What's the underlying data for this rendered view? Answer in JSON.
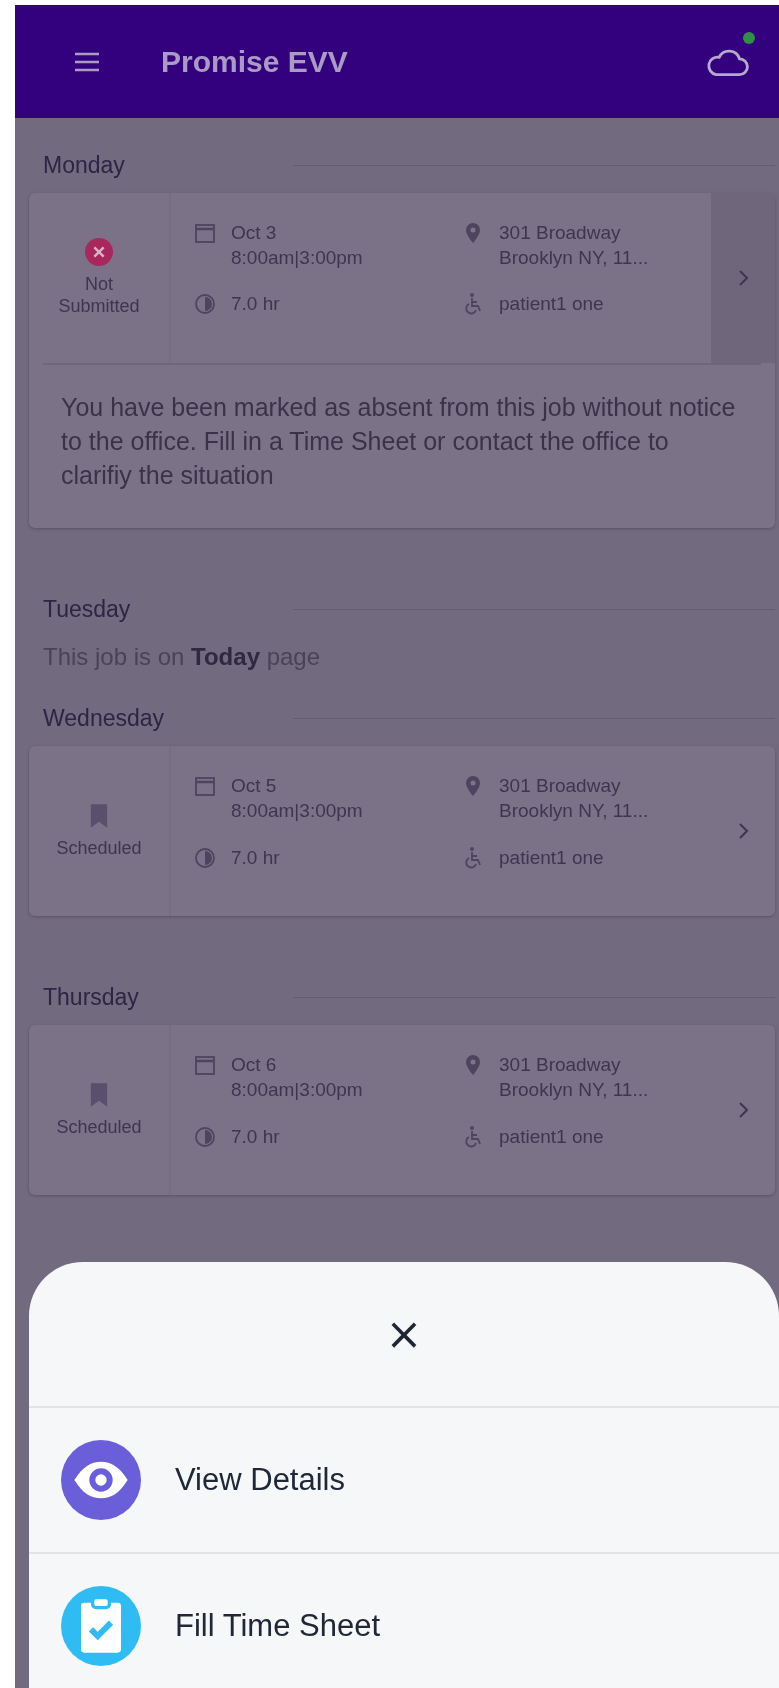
{
  "header": {
    "title": "Promise EVV",
    "connected": true
  },
  "days": [
    {
      "day": "Monday",
      "jobs": [
        {
          "status": {
            "kind": "not_submitted",
            "label": "Not Submitted"
          },
          "date": "Oct 3",
          "time": "8:00am|3:00pm",
          "hours": "7.0 hr",
          "address_1": "301 Broadway",
          "address_2": "Brooklyn NY, 11...",
          "patient": "patient1 one",
          "selected": true,
          "message": "You have been marked as absent from this job without notice to the office. Fill in a Time Sheet or contact the office to clarifiy the situation"
        }
      ]
    },
    {
      "day": "Tuesday",
      "note": "This job is on **Today** page"
    },
    {
      "day": "Wednesday",
      "jobs": [
        {
          "status": {
            "kind": "scheduled",
            "label": "Scheduled"
          },
          "date": "Oct 5",
          "time": "8:00am|3:00pm",
          "hours": "7.0 hr",
          "address_1": "301 Broadway",
          "address_2": "Brooklyn NY, 11...",
          "patient": "patient1 one",
          "selected": false
        }
      ]
    },
    {
      "day": "Thursday",
      "jobs": [
        {
          "status": {
            "kind": "scheduled",
            "label": "Scheduled"
          },
          "date": "Oct 6",
          "time": "8:00am|3:00pm",
          "hours": "7.0 hr",
          "address_1": "301 Broadway",
          "address_2": "Brooklyn NY, 11...",
          "patient": "patient1 one",
          "selected": false
        }
      ]
    }
  ],
  "sheet": {
    "close": "×",
    "actions": [
      {
        "kind": "eye",
        "label": "View Details",
        "color": "#6b5fd9"
      },
      {
        "kind": "clipboard",
        "label": "Fill Time Sheet",
        "color": "#2ebcf2"
      }
    ]
  }
}
